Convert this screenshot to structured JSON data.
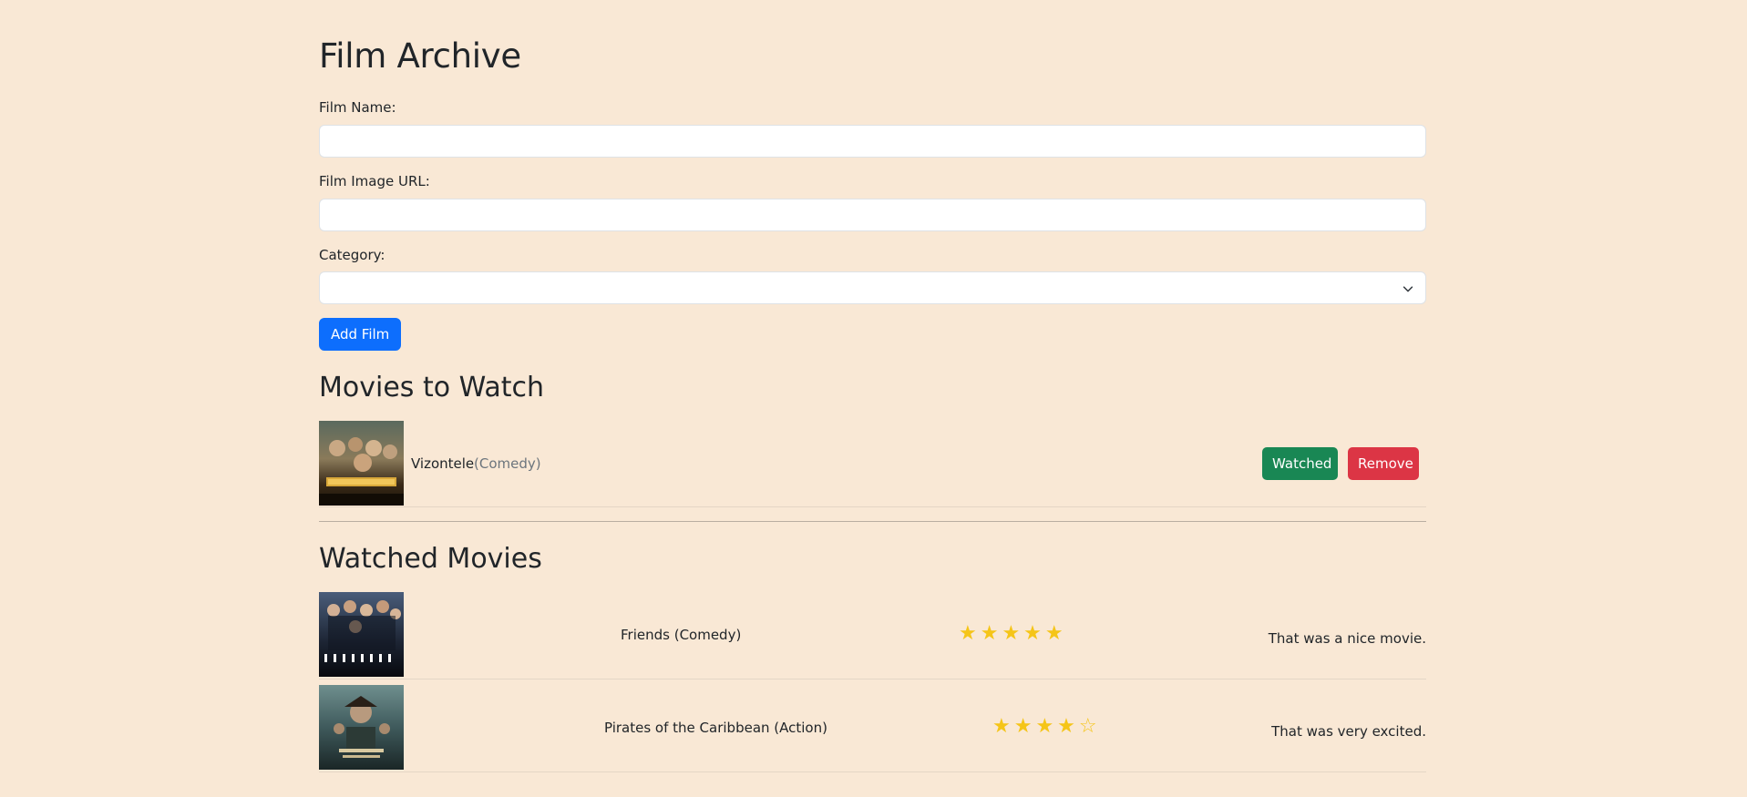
{
  "header": {
    "title": "Film Archive"
  },
  "form": {
    "film_name_label": "Film Name:",
    "film_name_value": "",
    "film_image_label": "Film Image URL:",
    "film_image_value": "",
    "category_label": "Category:",
    "category_value": "",
    "add_button_label": "Add Film"
  },
  "to_watch": {
    "title": "Movies to Watch",
    "items": [
      {
        "name": "Vizontele",
        "category": "(Comedy)",
        "watched_label": "Watched",
        "remove_label": "Remove"
      }
    ]
  },
  "watched": {
    "title": "Watched Movies",
    "items": [
      {
        "title": "Friends (Comedy)",
        "rating": 5,
        "stars": "★★★★★",
        "review": "That was a nice movie."
      },
      {
        "title": "Pirates of the Caribbean (Action)",
        "rating": 4,
        "stars": "★★★★☆",
        "review": "That was very excited."
      }
    ]
  },
  "colors": {
    "background": "#f9e8d5",
    "primary": "#0d6efd",
    "success": "#198754",
    "danger": "#dc3545",
    "star": "#f5c518"
  },
  "icons": {
    "select_chevron": "chevron-down-icon"
  }
}
